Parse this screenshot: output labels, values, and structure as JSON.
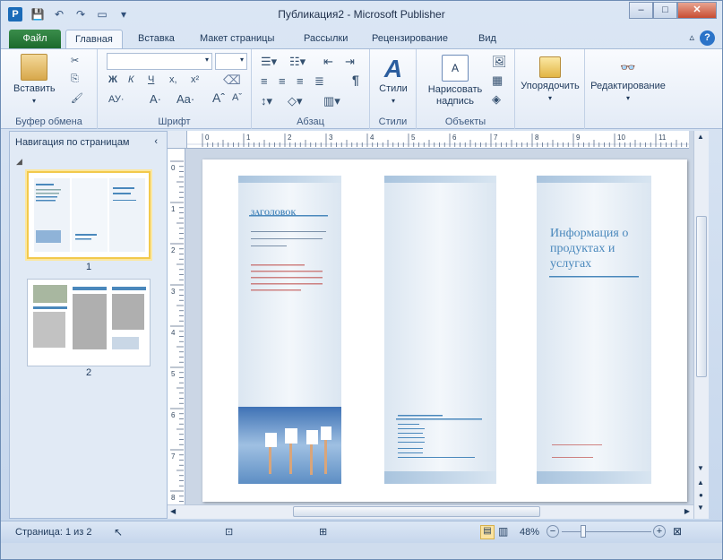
{
  "titlebar": {
    "app_icon": "P",
    "title": "Публикация2 - Microsoft Publisher",
    "qat_icons": [
      "save-icon",
      "undo-icon",
      "redo-icon",
      "print-preview-icon",
      "customize-qat-icon"
    ],
    "minimize": "–",
    "maximize": "□",
    "close": "✕"
  },
  "tabs": {
    "file": "Файл",
    "items": [
      "Главная",
      "Вставка",
      "Макет страницы",
      "Рассылки",
      "Рецензирование",
      "Вид"
    ],
    "active": "Главная",
    "help": "?"
  },
  "ribbon": {
    "clipboard": {
      "paste": "Вставить",
      "label": "Буфер обмена"
    },
    "font": {
      "label": "Шрифт",
      "bold": "Ж",
      "italic": "К",
      "underline": "Ч",
      "subscript": "x,",
      "superscript": "x²",
      "case": "АУ·",
      "color": "A·",
      "size": "Aa·"
    },
    "paragraph": {
      "label": "Абзац"
    },
    "styles": {
      "button": "Стили",
      "label": "Стили"
    },
    "objects": {
      "draw": "Нарисовать надпись",
      "label": "Объекты"
    },
    "arrange": {
      "button": "Упорядочить"
    },
    "editing": {
      "button": "Редактирование"
    }
  },
  "nav": {
    "title": "Навигация по страницам",
    "pages": [
      "1",
      "2"
    ]
  },
  "page_content": {
    "left_heading": "ЗАГОЛОВОК",
    "right_title_1": "Информация о",
    "right_title_2": "продуктах и",
    "right_title_3": "услугах"
  },
  "ruler": {
    "h_ticks": [
      "0",
      "1",
      "2",
      "3",
      "4",
      "5",
      "6",
      "7",
      "8",
      "9",
      "10",
      "11"
    ],
    "v_ticks": [
      "0",
      "1",
      "2",
      "3",
      "4",
      "5",
      "6",
      "7",
      "8"
    ]
  },
  "status": {
    "page_info": "Страница: 1 из 2",
    "zoom": "48%"
  },
  "colors": {
    "accent": "#4a88bc",
    "file_tab": "#2a7a3a"
  }
}
